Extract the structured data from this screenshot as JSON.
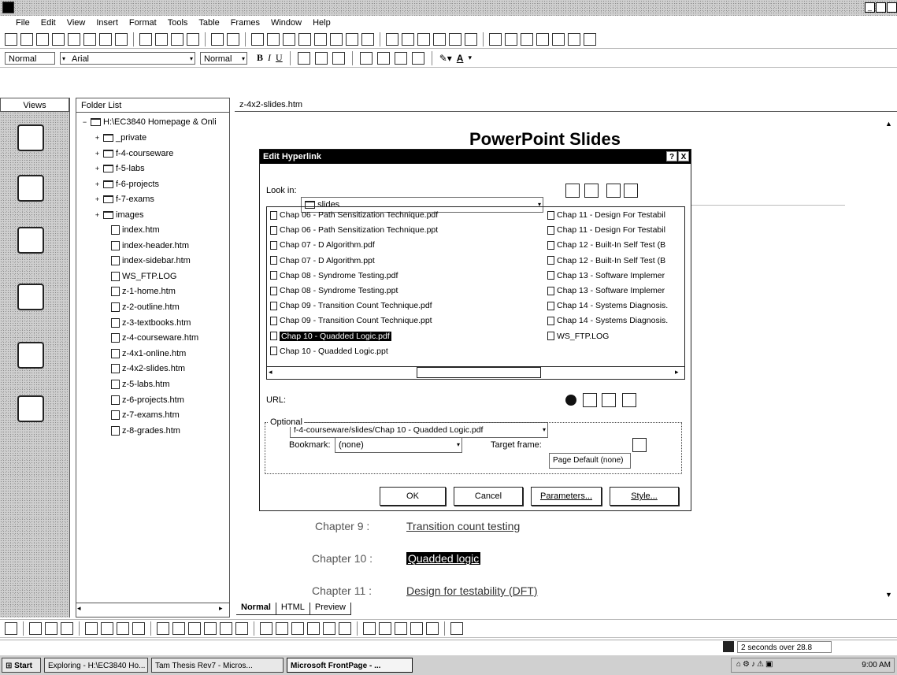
{
  "menu": [
    "File",
    "Edit",
    "View",
    "Insert",
    "Format",
    "Tools",
    "Table",
    "Frames",
    "Window",
    "Help"
  ],
  "format_bar": {
    "style": "Normal",
    "font": "Arial",
    "size": "Normal"
  },
  "views": {
    "header": "Views"
  },
  "folder": {
    "header": "Folder List",
    "root": "H:\\EC3840 Homepage & Onli",
    "folders": [
      "_private",
      "f-4-courseware",
      "f-5-labs",
      "f-6-projects",
      "f-7-exams",
      "images"
    ],
    "files": [
      "index.htm",
      "index-header.htm",
      "index-sidebar.htm",
      "WS_FTP.LOG",
      "z-1-home.htm",
      "z-2-outline.htm",
      "z-3-textbooks.htm",
      "z-4-courseware.htm",
      "z-4x1-online.htm",
      "z-4x2-slides.htm",
      "z-5-labs.htm",
      "z-6-projects.htm",
      "z-7-exams.htm",
      "z-8-grades.htm"
    ]
  },
  "document": {
    "tab": "z-4x2-slides.htm",
    "heading": "PowerPoint Slides",
    "chapters": [
      {
        "label": "Chapter 9 :",
        "link": "Transition count testing"
      },
      {
        "label": "Chapter 10 :",
        "link": "Quadded logic"
      },
      {
        "label": "Chapter 11 :",
        "link": "Design for testability (DFT)"
      }
    ],
    "view_tabs": [
      "Normal",
      "HTML",
      "Preview"
    ]
  },
  "dialog": {
    "title": "Edit Hyperlink",
    "help": "?",
    "close": "X",
    "look_in_label": "Look in:",
    "look_in_value": "slides",
    "files_left": [
      "Chap 06 - Path Sensitization Technique.pdf",
      "Chap 06 - Path Sensitization Technique.ppt",
      "Chap 07 - D Algorithm.pdf",
      "Chap 07 - D Algorithm.ppt",
      "Chap 08 - Syndrome Testing.pdf",
      "Chap 08 - Syndrome Testing.ppt",
      "Chap 09 - Transition Count Technique.pdf",
      "Chap 09 - Transition Count Technique.ppt",
      "Chap 10 - Quadded Logic.pdf",
      "Chap 10 - Quadded Logic.ppt"
    ],
    "files_right": [
      "Chap 11 - Design For Testabil",
      "Chap 11 - Design For Testabil",
      "Chap 12 - Built-In Self Test (B",
      "Chap 12 - Built-In Self Test (B",
      "Chap 13 - Software Implemer",
      "Chap 13 - Software Implemer",
      "Chap 14 - Systems Diagnosis.",
      "Chap 14 - Systems Diagnosis.",
      "WS_FTP.LOG"
    ],
    "url_label": "URL:",
    "url_value": "f-4-courseware/slides/Chap 10 - Quadded Logic.pdf",
    "optional_label": "Optional",
    "bookmark_label": "Bookmark:",
    "bookmark_value": "(none)",
    "target_label": "Target frame:",
    "target_value": "Page Default (none)",
    "ok": "OK",
    "cancel": "Cancel",
    "parameters": "Parameters...",
    "style": "Style..."
  },
  "status": {
    "progress": "2 seconds over 28.8"
  },
  "taskbar": {
    "start": "Start",
    "tasks": [
      "Exploring - H:\\EC3840 Ho...",
      "Tam Thesis Rev7 - Micros...",
      "Microsoft FrontPage - ..."
    ],
    "clock": "9:00 AM"
  }
}
